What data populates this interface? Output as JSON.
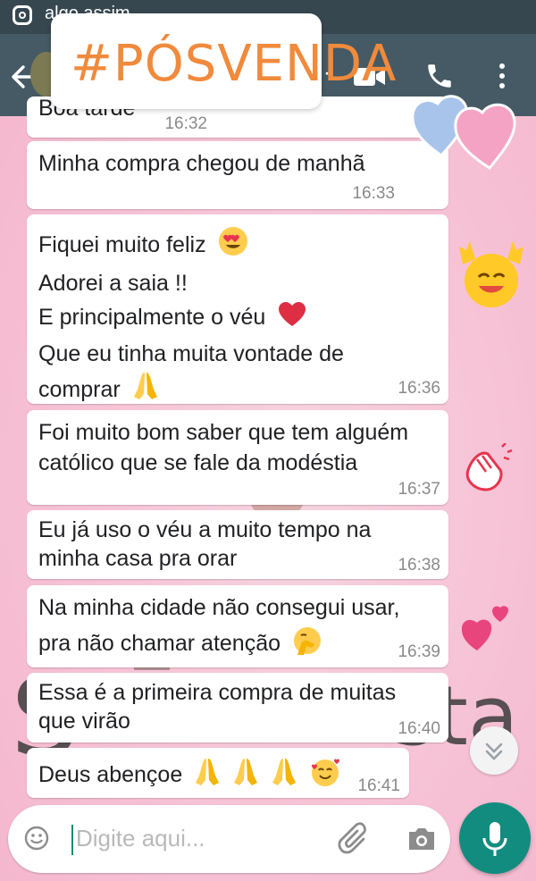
{
  "story": {
    "username": "algo assim",
    "hashtag": "#PÓSVENDA"
  },
  "chat": {
    "messages": [
      {
        "text_lines": [
          "Boa tarde"
        ],
        "time": "16:32"
      },
      {
        "text_lines": [
          "Minha compra chegou de manhã"
        ],
        "time": "16:33"
      },
      {
        "text_lines": [
          "Fiquei muito feliz",
          "Adorei a saia !!",
          "E principalmente o véu",
          "Que eu tinha muita vontade de",
          "comprar"
        ],
        "time": "16:36"
      },
      {
        "text_lines": [
          "Foi muito bom saber que tem alguém",
          "católico que se fale da modéstia"
        ],
        "time": "16:37"
      },
      {
        "text_lines": [
          "Eu já uso o véu a muito tempo na",
          "minha casa pra orar"
        ],
        "time": "16:38"
      },
      {
        "text_lines": [
          "Na minha cidade não consegui usar,",
          "pra não chamar atenção"
        ],
        "time": "16:39"
      },
      {
        "text_lines": [
          "Essa é a primeira compra de muitas",
          "que virão"
        ],
        "time": "16:40"
      },
      {
        "text_lines": [
          "Deus abençoe"
        ],
        "time": "16:41"
      }
    ]
  },
  "input": {
    "placeholder": "Digite aqui..."
  },
  "background": {
    "watermark_left": "S",
    "watermark_right": "sta"
  },
  "icons": {
    "emoji": "emoji-icon",
    "attach": "paperclip-icon",
    "camera": "camera-icon",
    "mic": "mic-icon",
    "video": "video-call-icon",
    "phone": "phone-call-icon",
    "menu": "more-vert-icon",
    "back": "arrow-back-icon"
  },
  "colors": {
    "header": "#455a64",
    "hashtag": "#f08a3c",
    "mic_button": "#128c7e",
    "chat_background": "#f7c3d6"
  }
}
